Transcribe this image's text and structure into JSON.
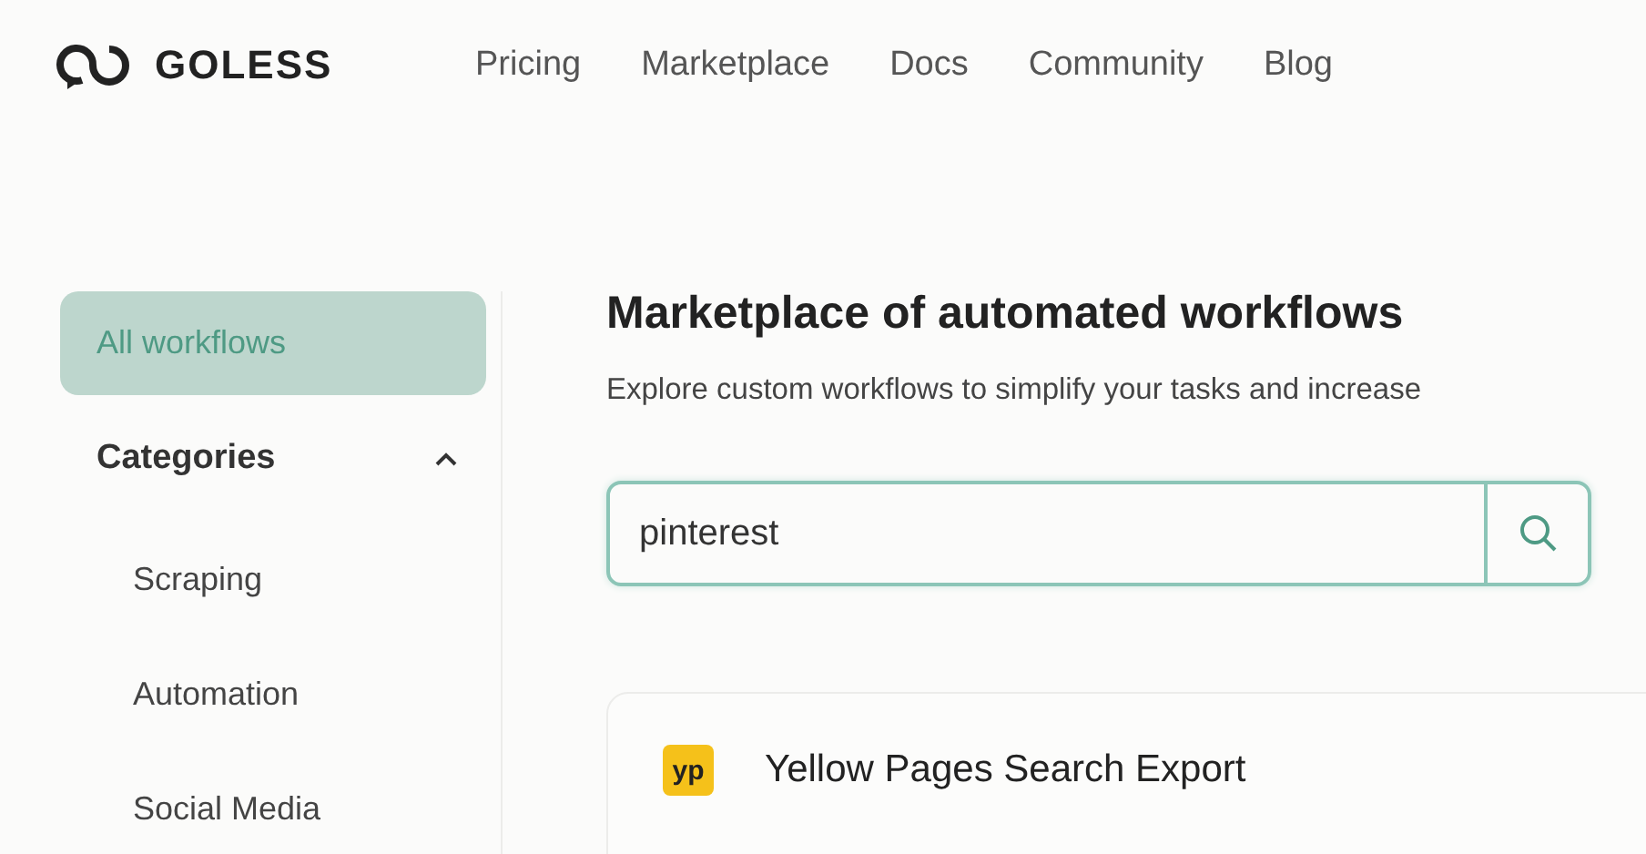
{
  "header": {
    "logo": "GOLESS",
    "nav": [
      "Pricing",
      "Marketplace",
      "Docs",
      "Community",
      "Blog"
    ]
  },
  "sidebar": {
    "items": [
      {
        "label": "All workflows",
        "selected": true
      }
    ],
    "categories": {
      "label": "Categories",
      "expanded": true,
      "children": [
        {
          "label": "Scraping",
          "selected": false
        },
        {
          "label": "Automation",
          "selected": false
        },
        {
          "label": "Social Media",
          "selected": false
        }
      ]
    }
  },
  "main": {
    "title": "Marketplace of automated workflows",
    "subtitle": "Explore custom workflows to simplify your tasks and increase",
    "search": {
      "value": "pinterest"
    },
    "results": [
      {
        "badge": "yp",
        "title": "Yellow Pages Search Export"
      }
    ]
  }
}
